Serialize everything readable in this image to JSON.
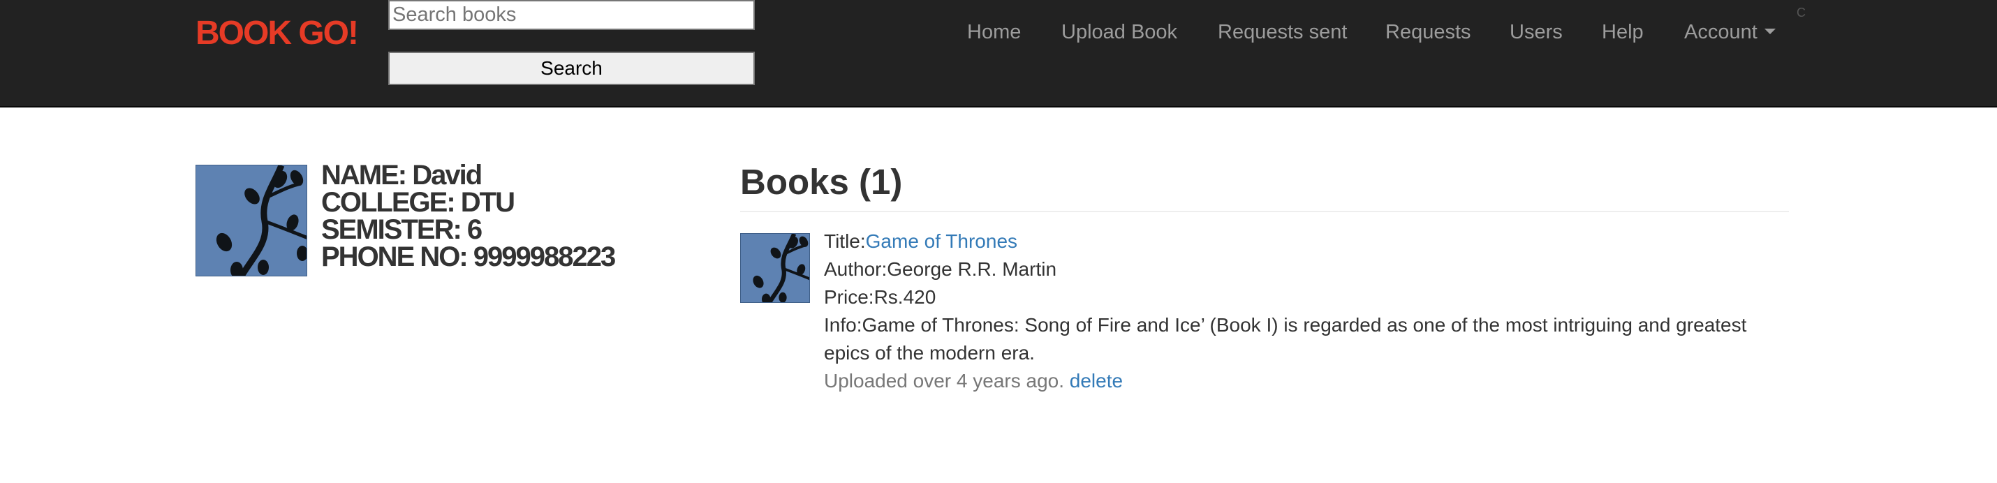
{
  "navbar": {
    "brand": "BOOK GO!",
    "search_placeholder": "Search books",
    "search_button": "Search",
    "links": [
      "Home",
      "Upload Book",
      "Requests sent",
      "Requests",
      "Users",
      "Help",
      "Account"
    ],
    "corner_mark": "C"
  },
  "profile": {
    "avatar_icon": "tree-branch-image",
    "name": "NAME: David",
    "college": "COLLEGE: DTU",
    "semester": "SEMISTER: 6",
    "phone": "PHONE NO: 9999988223"
  },
  "books": {
    "heading": "Books (1)",
    "items": [
      {
        "thumb_icon": "tree-branch-image",
        "title_label": "Title:",
        "title": "Game of Thrones",
        "author_label": "Author:",
        "author": "George R.R. Martin",
        "price_label": "Price:",
        "price": "Rs.420",
        "info_label": "Info:",
        "info": "Game of Thrones: Song of Fire and Ice’ (Book I) is regarded as one of the most intriguing and greatest epics of the modern era.",
        "uploaded": "Uploaded over 4 years ago.",
        "delete_label": "delete"
      }
    ]
  },
  "colors": {
    "navbar_bg": "#222222",
    "brand": "#e63b26",
    "nav_link": "#9d9d9d",
    "link": "#337ab7",
    "text": "#333333",
    "muted": "#777777"
  }
}
